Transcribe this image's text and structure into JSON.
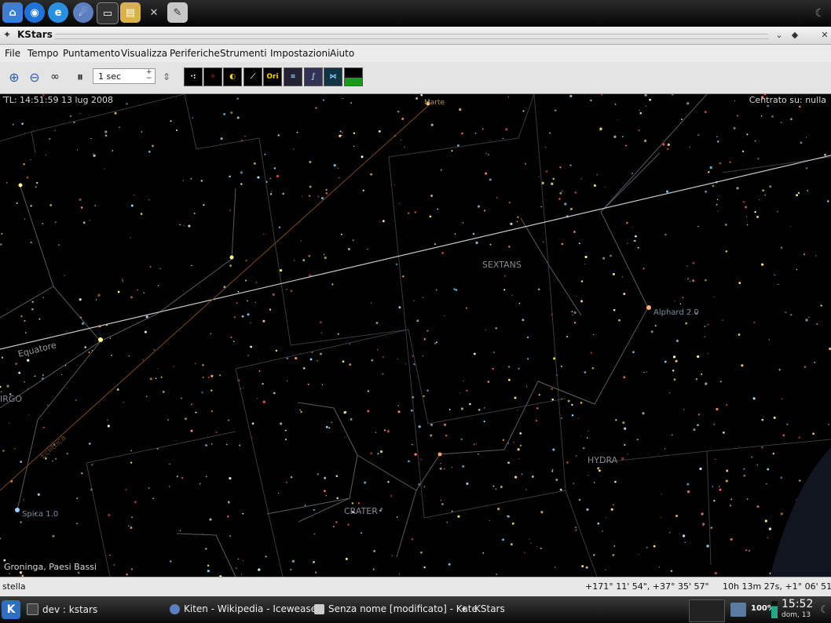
{
  "top_panel": {
    "launchers": [
      {
        "icon": "home-icon",
        "color": "#3a7fd5"
      },
      {
        "icon": "kde-globe-icon",
        "color": "#1e73d8"
      },
      {
        "icon": "konqueror-icon",
        "color": "#2a8fe0"
      },
      {
        "icon": "iceweasel-icon",
        "color": "#5d7fbf"
      },
      {
        "icon": "terminal-icon",
        "color": "#333333"
      },
      {
        "icon": "file-manager-icon",
        "color": "#d8b050"
      },
      {
        "icon": "tools-icon",
        "color": "#9a9a9a"
      },
      {
        "icon": "text-editor-icon",
        "color": "#c8c8c8"
      }
    ]
  },
  "window": {
    "title": "KStars",
    "controls": [
      "minimize",
      "maximize",
      "close"
    ]
  },
  "menu": {
    "items": [
      "File",
      "Tempo",
      "Puntamento",
      "Visualizza",
      "Periferiche",
      "Strumenti",
      "Impostazioni",
      "Aiuto"
    ]
  },
  "toolbar": {
    "time_step": "1 sec",
    "tools": [
      "zoom-in-icon",
      "zoom-out-icon",
      "binoculars-icon",
      "pause-icon"
    ],
    "sky_toggles": [
      "stars-toggle-icon",
      "deep-sky-toggle-icon",
      "solar-system-toggle-icon",
      "constellation-lines-icon",
      "constellation-names-icon",
      "constellation-boundaries-icon",
      "milky-way-icon",
      "coordinate-grid-icon",
      "horizon-icon"
    ],
    "sky_toggle_ori_label": "Ori"
  },
  "sky": {
    "time_label": "TL: 14:51:59   13 lug 2008",
    "centered": "Centrato su: nulla",
    "location": "Groninga, Paesi Bassi",
    "labels": {
      "marte": "Marte",
      "sextans": "SEXTANS",
      "alphard": "Alphard 2.0",
      "equatore": "Equatore",
      "eclittica": "Eclittica",
      "virgo": "IRGO",
      "spica": "Spica 1.0",
      "crater": "CRATER",
      "hydra": "HYDRA"
    }
  },
  "status": {
    "object": "stella",
    "altaz": "+171° 11' 54\",  +37° 35' 57\"",
    "radec": "10h 13m 27s,  +1° 06' 51\""
  },
  "taskbar": {
    "tasks": [
      "dev : kstars",
      "Kiten - Wikipedia - Iceweasel",
      "Senza nome [modificato] - Kate",
      "KStars"
    ],
    "battery": "100%",
    "clock_time": "15:52",
    "clock_date": "dom, 13"
  }
}
